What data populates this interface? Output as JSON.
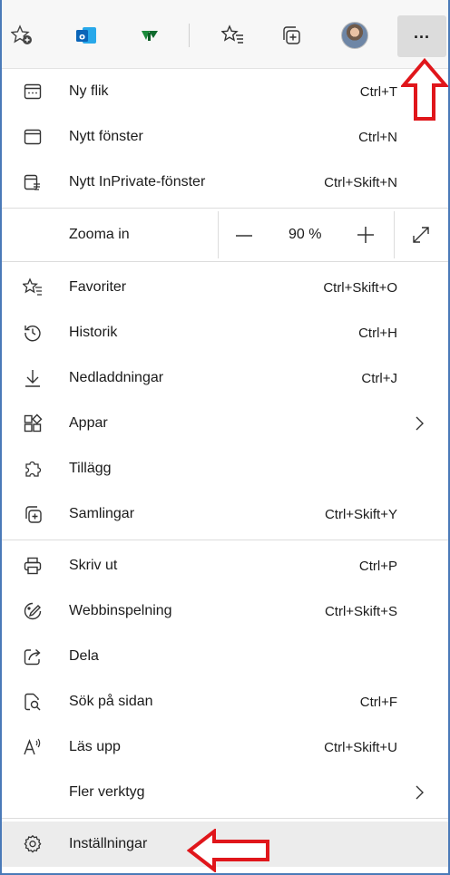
{
  "toolbar": {
    "buttons": [
      {
        "name": "add-favorite-icon"
      },
      {
        "name": "outlook-extension-icon"
      },
      {
        "name": "extension-icon"
      },
      {
        "name": "favorites-icon"
      },
      {
        "name": "collections-icon"
      },
      {
        "name": "profile-avatar"
      },
      {
        "name": "more-options-icon"
      }
    ],
    "more_label": "..."
  },
  "menu": {
    "new_tab": {
      "label": "Ny flik",
      "shortcut": "Ctrl+T"
    },
    "new_window": {
      "label": "Nytt fönster",
      "shortcut": "Ctrl+N"
    },
    "new_inprivate": {
      "label": "Nytt InPrivate-fönster",
      "shortcut": "Ctrl+Skift+N"
    },
    "zoom": {
      "label": "Zooma in",
      "value": "90 %"
    },
    "favorites": {
      "label": "Favoriter",
      "shortcut": "Ctrl+Skift+O"
    },
    "history": {
      "label": "Historik",
      "shortcut": "Ctrl+H"
    },
    "downloads": {
      "label": "Nedladdningar",
      "shortcut": "Ctrl+J"
    },
    "apps": {
      "label": "Appar"
    },
    "extensions": {
      "label": "Tillägg"
    },
    "collections": {
      "label": "Samlingar",
      "shortcut": "Ctrl+Skift+Y"
    },
    "print": {
      "label": "Skriv ut",
      "shortcut": "Ctrl+P"
    },
    "web_capture": {
      "label": "Webbinspelning",
      "shortcut": "Ctrl+Skift+S"
    },
    "share": {
      "label": "Dela"
    },
    "find": {
      "label": "Sök på sidan",
      "shortcut": "Ctrl+F"
    },
    "read_aloud": {
      "label": "Läs upp",
      "shortcut": "Ctrl+Skift+U"
    },
    "more_tools": {
      "label": "Fler verktyg"
    },
    "settings": {
      "label": "Inställningar"
    }
  },
  "colors": {
    "annotation_arrow": "#e0161b",
    "frame_border": "#4a7ab8",
    "highlight": "#ececec"
  }
}
